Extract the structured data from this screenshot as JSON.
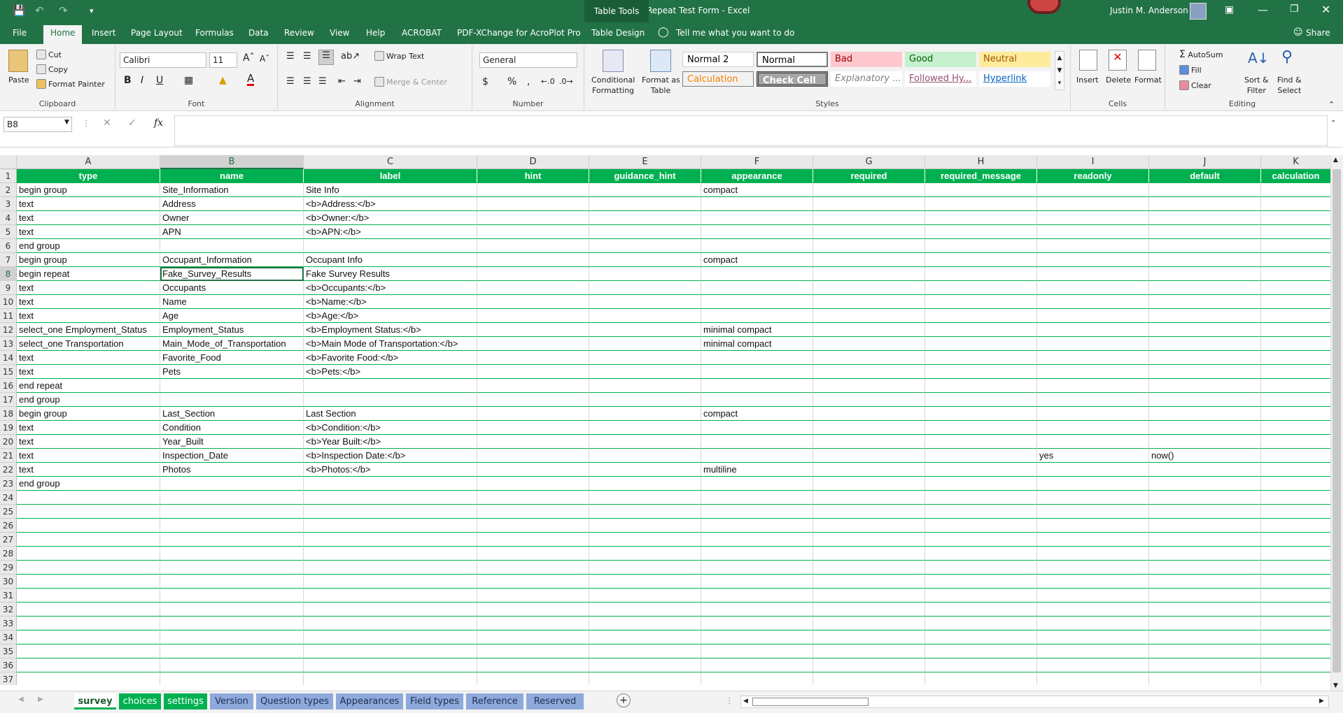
{
  "titlebar": {
    "title": "Fake Survey Repeat Test Form  -  Excel",
    "context": "Table Tools",
    "user": "Justin M. Anderson"
  },
  "tabs": [
    "File",
    "Home",
    "Insert",
    "Page Layout",
    "Formulas",
    "Data",
    "Review",
    "View",
    "Help",
    "ACROBAT",
    "PDF-XChange for AcroPlot Pro",
    "Table Design"
  ],
  "tell_me": "Tell me what you want to do",
  "share": "Share",
  "ribbon": {
    "clipboard": {
      "label": "Clipboard",
      "paste": "Paste",
      "cut": "Cut",
      "copy": "Copy",
      "format_painter": "Format Painter"
    },
    "font": {
      "label": "Font",
      "name": "Calibri",
      "size": "11"
    },
    "alignment": {
      "label": "Alignment",
      "wrap": "Wrap Text",
      "merge": "Merge & Center"
    },
    "number": {
      "label": "Number",
      "format": "General"
    },
    "styles": {
      "label": "Styles",
      "conditional": [
        "Conditional",
        "Formatting"
      ],
      "format_table": [
        "Format as",
        "Table"
      ],
      "cells": [
        {
          "label": "Normal 2",
          "bg": "#ffffff",
          "fg": "#000000"
        },
        {
          "label": "Normal",
          "bg": "#ffffff",
          "fg": "#000000"
        },
        {
          "label": "Bad",
          "bg": "#ffc7ce",
          "fg": "#9c0006"
        },
        {
          "label": "Good",
          "bg": "#c6efce",
          "fg": "#006100"
        },
        {
          "label": "Neutral",
          "bg": "#ffeb9c",
          "fg": "#9c5700"
        },
        {
          "label": "Calculation",
          "bg": "#f2f2f2",
          "fg": "#fa7d00"
        },
        {
          "label": "Check Cell",
          "bg": "#a5a5a5",
          "fg": "#ffffff"
        },
        {
          "label": "Explanatory ...",
          "bg": "#ffffff",
          "fg": "#7f7f7f"
        },
        {
          "label": "Followed Hy...",
          "bg": "#ffffff",
          "fg": "#954f72"
        },
        {
          "label": "Hyperlink",
          "bg": "#ffffff",
          "fg": "#0563c1"
        }
      ]
    },
    "cells": {
      "label": "Cells",
      "insert": "Insert",
      "delete": "Delete",
      "format": "Format"
    },
    "editing": {
      "label": "Editing",
      "autosum": "AutoSum",
      "fill": "Fill",
      "clear": "Clear",
      "sort": [
        "Sort &",
        "Filter"
      ],
      "find": [
        "Find &",
        "Select"
      ]
    }
  },
  "formula_bar": {
    "name_box": "B8",
    "formula": ""
  },
  "columns": [
    "A",
    "B",
    "C",
    "D",
    "E",
    "F",
    "G",
    "H",
    "I",
    "J",
    "K"
  ],
  "rows": [
    [
      "type",
      "name",
      "label",
      "hint",
      "guidance_hint",
      "appearance",
      "required",
      "required_message",
      "readonly",
      "default",
      "calculation"
    ],
    [
      "begin group",
      "Site_Information",
      "Site Info",
      "",
      "",
      "compact",
      "",
      "",
      "",
      "",
      ""
    ],
    [
      "text",
      "Address",
      "<b>Address:</b>",
      "",
      "",
      "",
      "",
      "",
      "",
      "",
      ""
    ],
    [
      "text",
      "Owner",
      "<b>Owner:</b>",
      "",
      "",
      "",
      "",
      "",
      "",
      "",
      ""
    ],
    [
      "text",
      "APN",
      "<b>APN:</b>",
      "",
      "",
      "",
      "",
      "",
      "",
      "",
      ""
    ],
    [
      "end group",
      "",
      "",
      "",
      "",
      "",
      "",
      "",
      "",
      "",
      ""
    ],
    [
      "begin group",
      "Occupant_Information",
      "Occupant Info",
      "",
      "",
      "compact",
      "",
      "",
      "",
      "",
      ""
    ],
    [
      "begin repeat",
      "Fake_Survey_Results",
      "Fake Survey Results",
      "",
      "",
      "",
      "",
      "",
      "",
      "",
      ""
    ],
    [
      "text",
      "Occupants",
      "<b>Occupants:</b>",
      "",
      "",
      "",
      "",
      "",
      "",
      "",
      ""
    ],
    [
      "text",
      "Name",
      "<b>Name:</b>",
      "",
      "",
      "",
      "",
      "",
      "",
      "",
      ""
    ],
    [
      "text",
      "Age",
      "<b>Age:</b>",
      "",
      "",
      "",
      "",
      "",
      "",
      "",
      ""
    ],
    [
      "select_one Employment_Status",
      "Employment_Status",
      "<b>Employment Status:</b>",
      "",
      "",
      "minimal compact",
      "",
      "",
      "",
      "",
      ""
    ],
    [
      "select_one Transportation",
      "Main_Mode_of_Transportation",
      "<b>Main Mode of Transportation:</b>",
      "",
      "",
      "minimal compact",
      "",
      "",
      "",
      "",
      ""
    ],
    [
      "text",
      "Favorite_Food",
      "<b>Favorite Food:</b>",
      "",
      "",
      "",
      "",
      "",
      "",
      "",
      ""
    ],
    [
      "text",
      "Pets",
      "<b>Pets:</b>",
      "",
      "",
      "",
      "",
      "",
      "",
      "",
      ""
    ],
    [
      "end repeat",
      "",
      "",
      "",
      "",
      "",
      "",
      "",
      "",
      "",
      ""
    ],
    [
      "end group",
      "",
      "",
      "",
      "",
      "",
      "",
      "",
      "",
      "",
      ""
    ],
    [
      "begin group",
      "Last_Section",
      "Last Section",
      "",
      "",
      "compact",
      "",
      "",
      "",
      "",
      ""
    ],
    [
      "text",
      "Condition",
      "<b>Condition:</b>",
      "",
      "",
      "",
      "",
      "",
      "",
      "",
      ""
    ],
    [
      "text",
      "Year_Built",
      "<b>Year Built:</b>",
      "",
      "",
      "",
      "",
      "",
      "",
      "",
      ""
    ],
    [
      "text",
      "Inspection_Date",
      "<b>Inspection Date:</b>",
      "",
      "",
      "",
      "",
      "",
      "yes",
      "now()",
      ""
    ],
    [
      "text",
      "Photos",
      "<b>Photos:</b>",
      "",
      "",
      "multiline",
      "",
      "",
      "",
      "",
      ""
    ],
    [
      "end group",
      "",
      "",
      "",
      "",
      "",
      "",
      "",
      "",
      "",
      ""
    ]
  ],
  "total_rows": 37,
  "sheet_tabs": [
    {
      "label": "survey",
      "bg": "#00b050",
      "fg": "#1e5c2e",
      "active": true
    },
    {
      "label": "choices",
      "bg": "#00b050",
      "fg": "#ffffff"
    },
    {
      "label": "settings",
      "bg": "#00b050",
      "fg": "#ffffff"
    },
    {
      "label": "Version",
      "bg": "#8ea9db",
      "fg": "#1f2f4f"
    },
    {
      "label": "Question types",
      "bg": "#8ea9db",
      "fg": "#1f2f4f"
    },
    {
      "label": "Appearances",
      "bg": "#8ea9db",
      "fg": "#1f2f4f"
    },
    {
      "label": "Field types",
      "bg": "#8ea9db",
      "fg": "#1f2f4f"
    },
    {
      "label": "Reference",
      "bg": "#8ea9db",
      "fg": "#1f2f4f"
    },
    {
      "label": "Reserved",
      "bg": "#8ea9db",
      "fg": "#1f2f4f"
    }
  ]
}
